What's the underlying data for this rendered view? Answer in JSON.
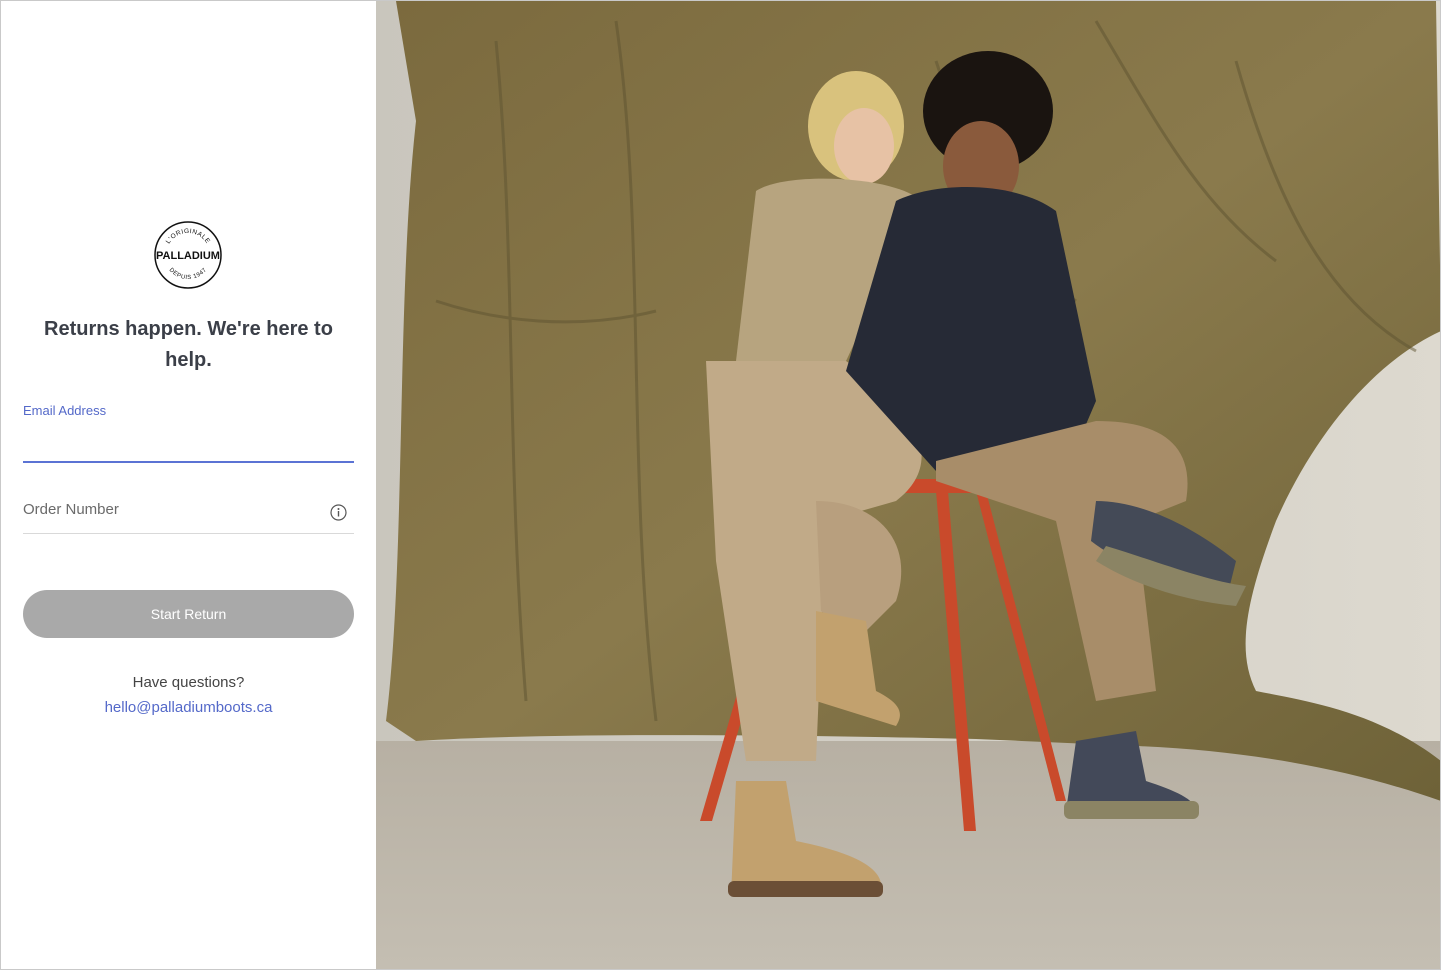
{
  "brand": {
    "logo_top_text": "L'ORIGINALE",
    "logo_main_text": "PALLADIUM",
    "logo_bottom_text": "DEPUIS 1947"
  },
  "form": {
    "headline": "Returns happen. We're here to help.",
    "email_label": "Email Address",
    "email_value": "",
    "order_placeholder": "Order Number",
    "order_value": "",
    "submit_label": "Start Return"
  },
  "help": {
    "question": "Have questions?",
    "email_link": "hello@palladiumboots.ca"
  },
  "colors": {
    "accent": "#5469c9",
    "button_disabled": "#a9a9a9",
    "heading": "#3b3f48"
  },
  "icons": {
    "order_info": "info-icon"
  }
}
